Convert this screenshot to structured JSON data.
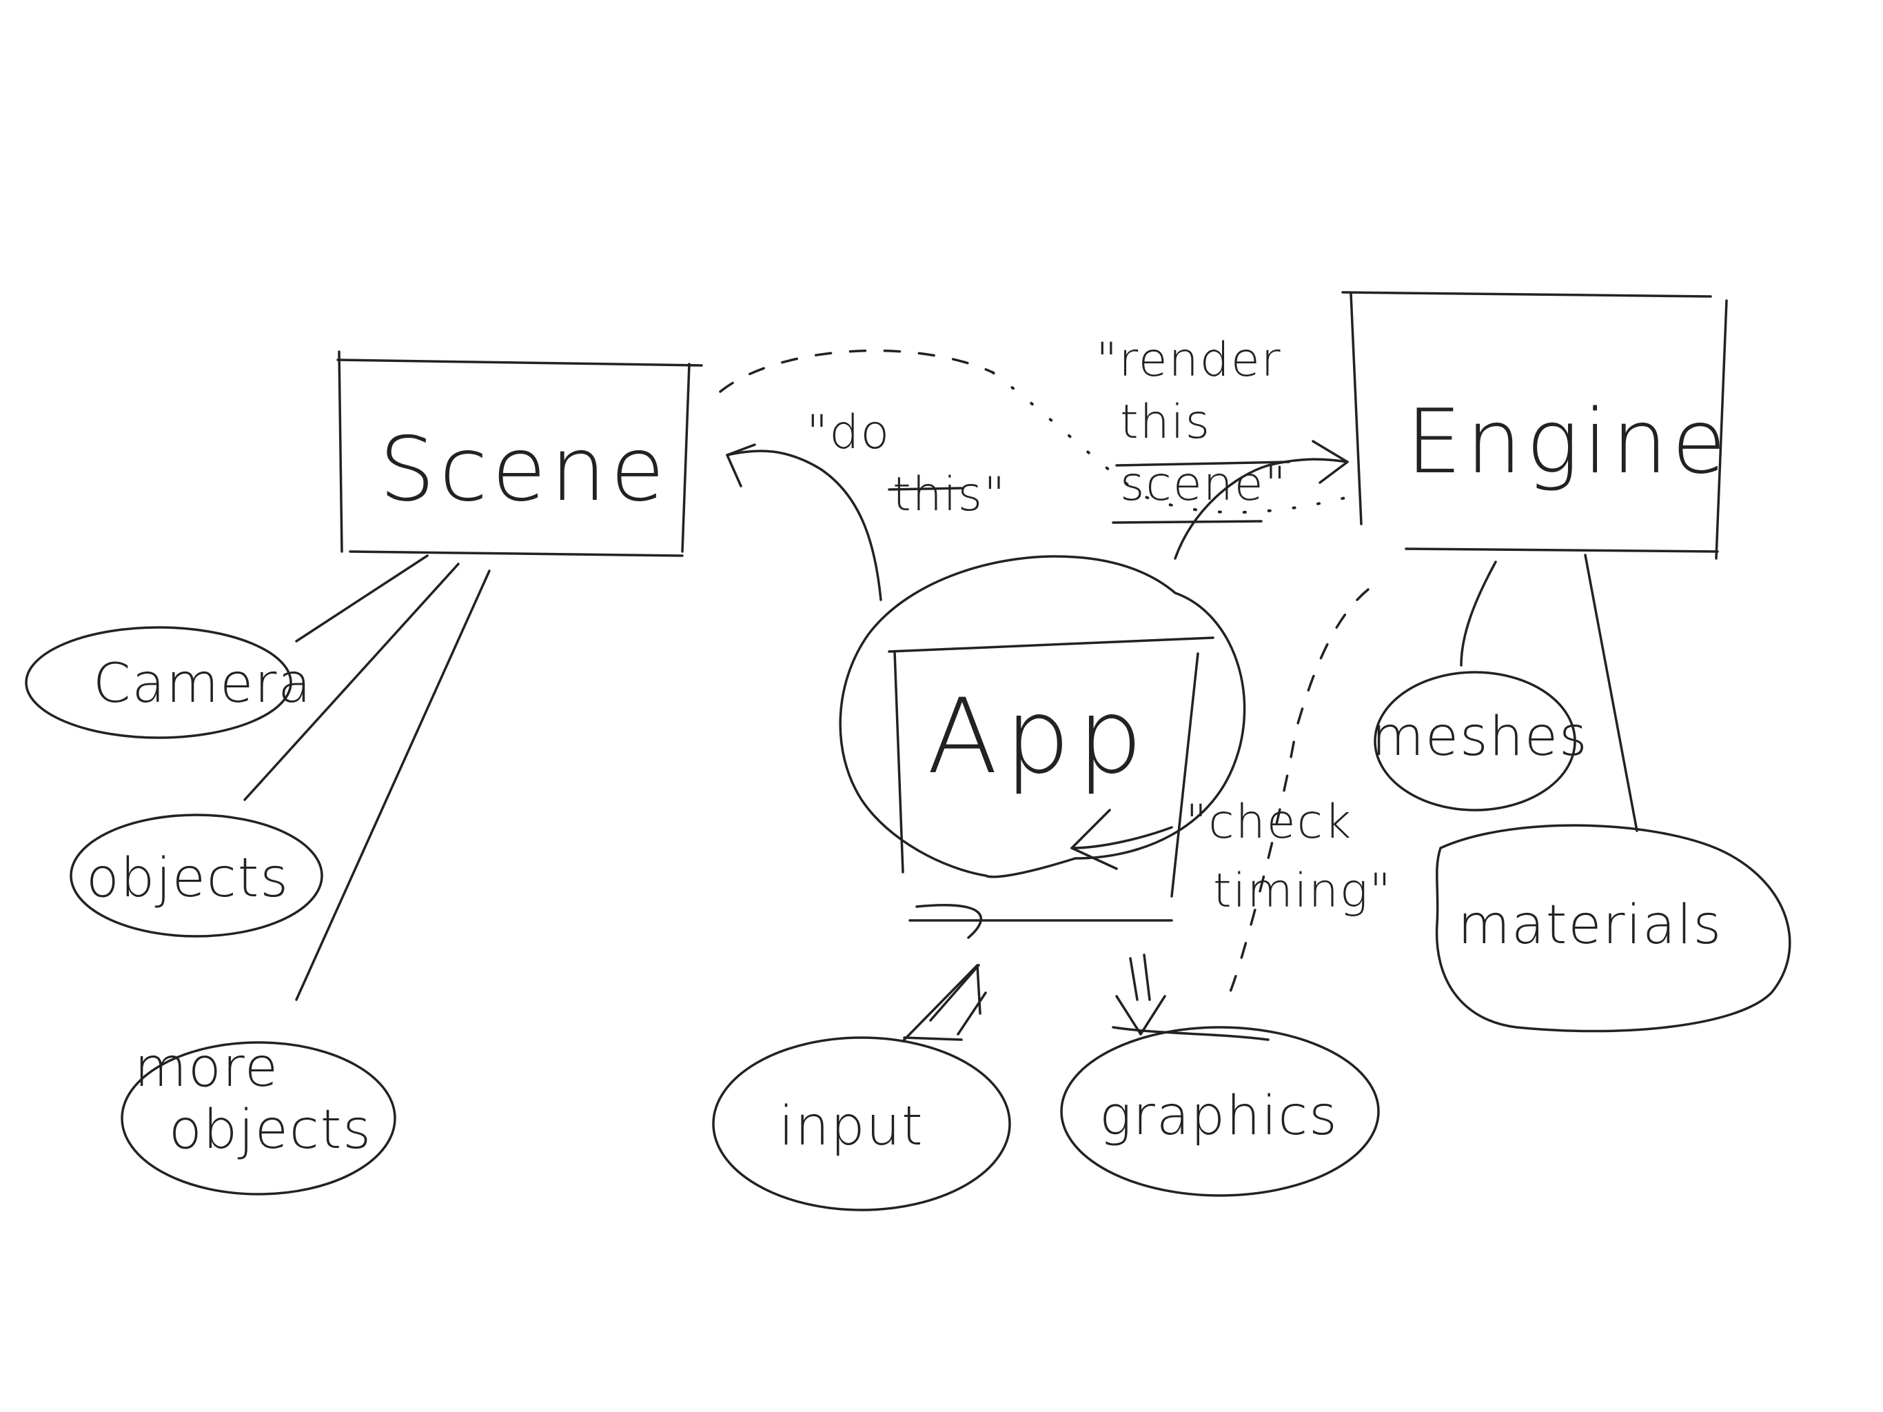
{
  "nodes": {
    "scene": "Scene",
    "engine": "Engine",
    "app": "App"
  },
  "bubbles": {
    "camera": "Camera",
    "objects": "objects",
    "more_objects_line1": "more",
    "more_objects_line2": "objects",
    "input": "input",
    "graphics": "graphics",
    "meshes": "meshes",
    "materials": "materials"
  },
  "annotations": {
    "do_this_line1": "\"do",
    "do_this_line2": "this\"",
    "render_line1": "\"render",
    "render_line2": "this",
    "render_line3": "scene\"",
    "check_line1": "\"check",
    "check_line2": "timing\""
  }
}
